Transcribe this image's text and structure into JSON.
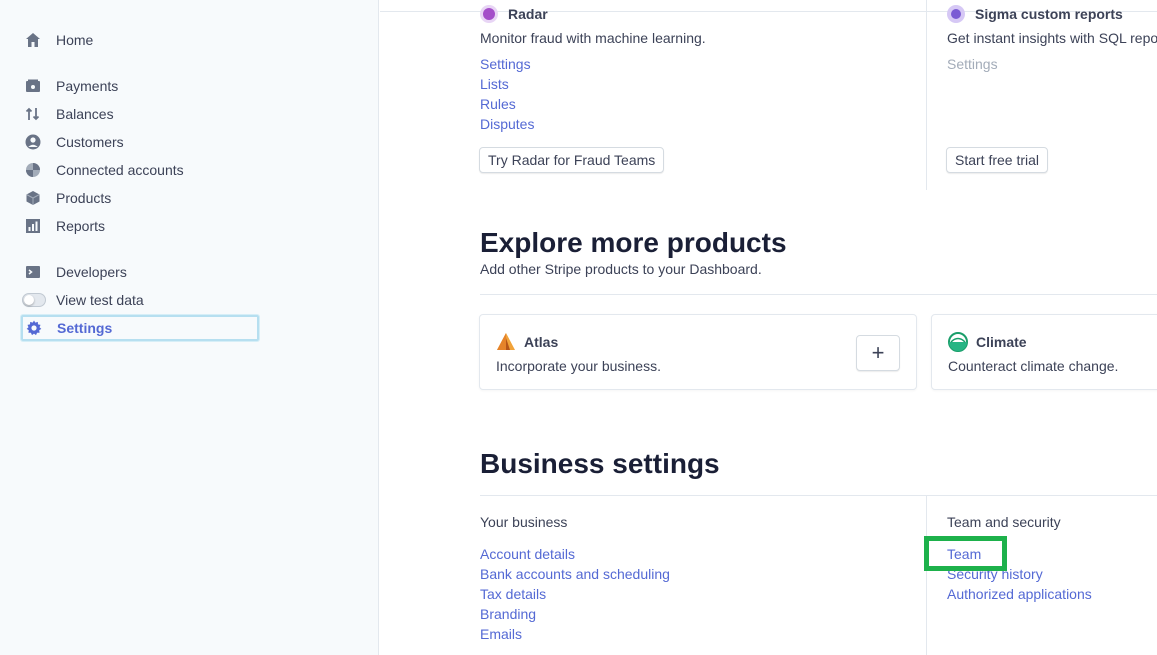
{
  "sidebar": {
    "home": "Home",
    "payments": "Payments",
    "balances": "Balances",
    "customers": "Customers",
    "connected_accounts": "Connected accounts",
    "products": "Products",
    "reports": "Reports",
    "developers": "Developers",
    "view_test_data": "View test data",
    "settings": "Settings"
  },
  "top_products": {
    "radar": {
      "name": "Radar",
      "description": "Monitor fraud with machine learning.",
      "links": [
        "Settings",
        "Lists",
        "Rules",
        "Disputes"
      ],
      "button": "Try Radar for Fraud Teams"
    },
    "sigma": {
      "name": "Sigma custom reports",
      "description": "Get instant insights with SQL repo",
      "links": [
        "Settings"
      ],
      "button": "Start free trial"
    }
  },
  "explore": {
    "title": "Explore more products",
    "subtitle": "Add other Stripe products to your Dashboard.",
    "cards": [
      {
        "name": "Atlas",
        "description": "Incorporate your business.",
        "add_label": "+"
      },
      {
        "name": "Climate",
        "description": "Counteract climate change."
      }
    ]
  },
  "business": {
    "title": "Business settings",
    "your_business": {
      "label": "Your business",
      "links": [
        "Account details",
        "Bank accounts and scheduling",
        "Tax details",
        "Branding",
        "Emails"
      ]
    },
    "team_security": {
      "label": "Team and security",
      "links": [
        "Team",
        "Security history",
        "Authorized applications"
      ]
    }
  },
  "colors": {
    "accent": "#5469d4",
    "highlight": "#1db14b",
    "sidebar_bg": "#f7fafc"
  }
}
